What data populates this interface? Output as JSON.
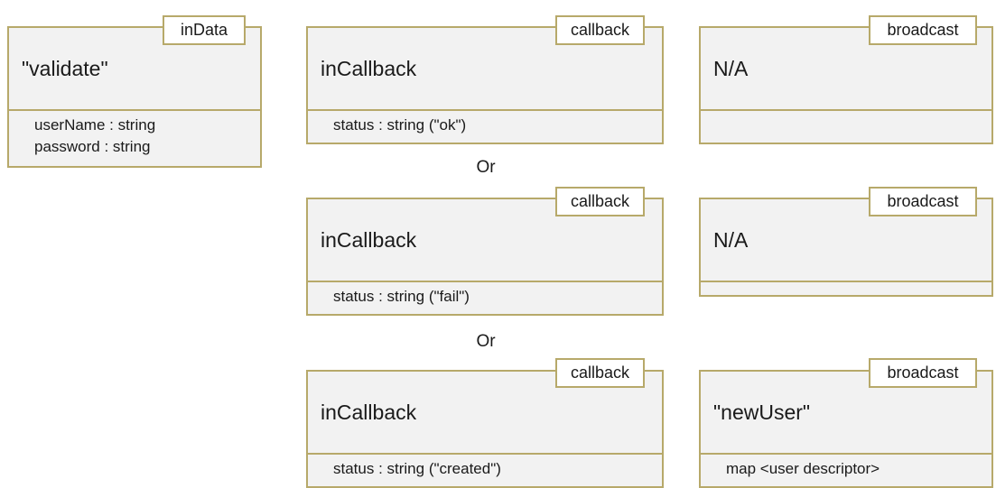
{
  "diagram": {
    "input": {
      "tag": "inData",
      "name": "\"validate\"",
      "attributes": [
        "userName : string",
        "password : string"
      ]
    },
    "callbacks": [
      {
        "tag": "callback",
        "name": "inCallback",
        "attributes": [
          "status : string (\"ok\")"
        ]
      },
      {
        "tag": "callback",
        "name": "inCallback",
        "attributes": [
          "status : string (\"fail\")"
        ]
      },
      {
        "tag": "callback",
        "name": "inCallback",
        "attributes": [
          "status : string (\"created\")"
        ]
      }
    ],
    "broadcasts": [
      {
        "tag": "broadcast",
        "name": "N/A",
        "attributes": []
      },
      {
        "tag": "broadcast",
        "name": "N/A",
        "attributes": []
      },
      {
        "tag": "broadcast",
        "name": "\"newUser\"",
        "attributes": [
          "map <user descriptor>"
        ]
      }
    ],
    "separators": [
      "Or",
      "Or"
    ]
  }
}
